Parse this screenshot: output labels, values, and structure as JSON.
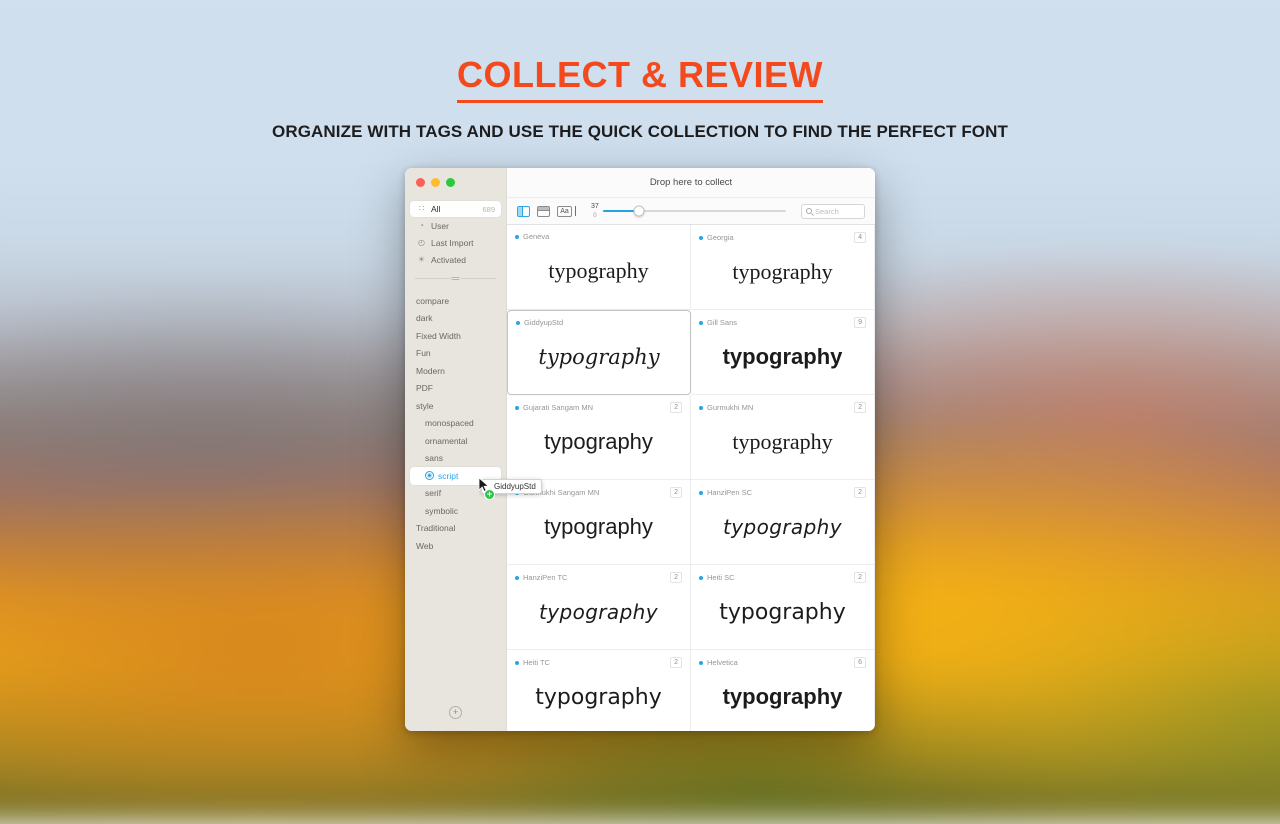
{
  "header": {
    "title": "COLLECT & REVIEW",
    "subtitle": "ORGANIZE WITH TAGS AND USE THE QUICK COLLECTION TO FIND THE PERFECT FONT",
    "accent_color": "#f4491c"
  },
  "window": {
    "drop_bar_text": "Drop here to collect"
  },
  "sidebar": {
    "smart_groups": [
      {
        "label": "All",
        "count": "689",
        "icon": "grid-icon",
        "selected": true
      },
      {
        "label": "User",
        "count": "",
        "icon": "user-icon",
        "selected": false
      },
      {
        "label": "Last Import",
        "count": "",
        "icon": "clock-icon",
        "selected": false
      },
      {
        "label": "Activated",
        "count": "",
        "icon": "sun-icon",
        "selected": false
      }
    ],
    "tags": [
      {
        "label": "compare",
        "indent": false,
        "selected": false
      },
      {
        "label": "dark",
        "indent": false,
        "selected": false
      },
      {
        "label": "Fixed Width",
        "indent": false,
        "selected": false
      },
      {
        "label": "Fun",
        "indent": false,
        "selected": false
      },
      {
        "label": "Modern",
        "indent": false,
        "selected": false
      },
      {
        "label": "PDF",
        "indent": false,
        "selected": false
      },
      {
        "label": "style",
        "indent": false,
        "selected": false
      },
      {
        "label": "monospaced",
        "indent": true,
        "selected": false
      },
      {
        "label": "ornamental",
        "indent": true,
        "selected": false
      },
      {
        "label": "sans",
        "indent": true,
        "selected": false
      },
      {
        "label": "script",
        "indent": true,
        "selected": true
      },
      {
        "label": "serif",
        "indent": true,
        "selected": false
      },
      {
        "label": "symbolic",
        "indent": true,
        "selected": false
      },
      {
        "label": "Traditional",
        "indent": false,
        "selected": false
      },
      {
        "label": "Web",
        "indent": false,
        "selected": false
      }
    ],
    "add_button_label": "+"
  },
  "toolbar": {
    "sidebar_toggle": "sidebar-toggle-icon",
    "window_view": "window-view-icon",
    "sample_text": "Aa",
    "slider_max_label": "37",
    "slider_min_label": "0",
    "slider_percent": 20,
    "search_placeholder": "Search"
  },
  "grid": {
    "cards": [
      {
        "name": "Geneva",
        "count": "",
        "sample": "typography",
        "style": "s-serif",
        "selected": false
      },
      {
        "name": "Georgia",
        "count": "4",
        "sample": "typography",
        "style": "s-serif",
        "selected": false
      },
      {
        "name": "GiddyupStd",
        "count": "",
        "sample": "typography",
        "style": "s-script",
        "selected": true
      },
      {
        "name": "Gill Sans",
        "count": "9",
        "sample": "typography",
        "style": "s-bold",
        "selected": false
      },
      {
        "name": "Gujarati Sangam MN",
        "count": "2",
        "sample": "typography",
        "style": "s-sans",
        "selected": false
      },
      {
        "name": "Gurmukhi MN",
        "count": "2",
        "sample": "typography",
        "style": "s-serif",
        "selected": false
      },
      {
        "name": "Gurmukhi Sangam MN",
        "count": "2",
        "sample": "typography",
        "style": "s-sans",
        "selected": false
      },
      {
        "name": "HanziPen SC",
        "count": "2",
        "sample": "typography",
        "style": "s-hand",
        "selected": false
      },
      {
        "name": "HanziPen TC",
        "count": "2",
        "sample": "typography",
        "style": "s-hand",
        "selected": false
      },
      {
        "name": "Heiti SC",
        "count": "2",
        "sample": "typography",
        "style": "s-dejavu",
        "selected": false
      },
      {
        "name": "Heiti TC",
        "count": "2",
        "sample": "typography",
        "style": "s-dejavu",
        "selected": false
      },
      {
        "name": "Helvetica",
        "count": "6",
        "sample": "typography",
        "style": "s-bold",
        "selected": false
      }
    ]
  },
  "drag": {
    "label": "GiddyupStd",
    "badge": "+"
  }
}
